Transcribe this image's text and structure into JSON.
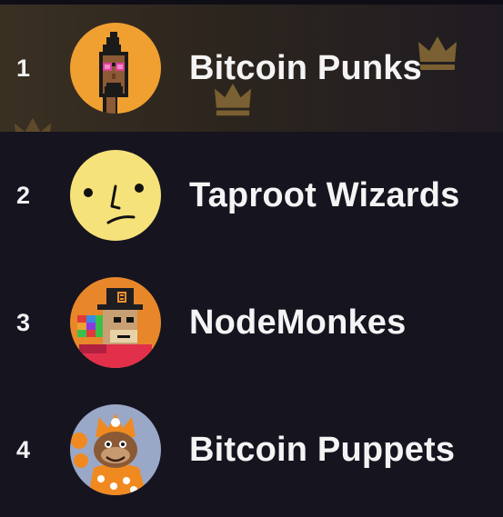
{
  "leaderboard": {
    "items": [
      {
        "rank": "1",
        "name": "Bitcoin Punks",
        "avatar": "bitcoin-punk-avatar"
      },
      {
        "rank": "2",
        "name": "Taproot Wizards",
        "avatar": "taproot-wizard-avatar"
      },
      {
        "rank": "3",
        "name": "NodeMonkes",
        "avatar": "nodemonke-avatar"
      },
      {
        "rank": "4",
        "name": "Bitcoin Puppets",
        "avatar": "bitcoin-puppet-avatar"
      }
    ],
    "highlight_color": "#3a3022",
    "crown_color": "#8a6d33",
    "background": "#16141f"
  }
}
